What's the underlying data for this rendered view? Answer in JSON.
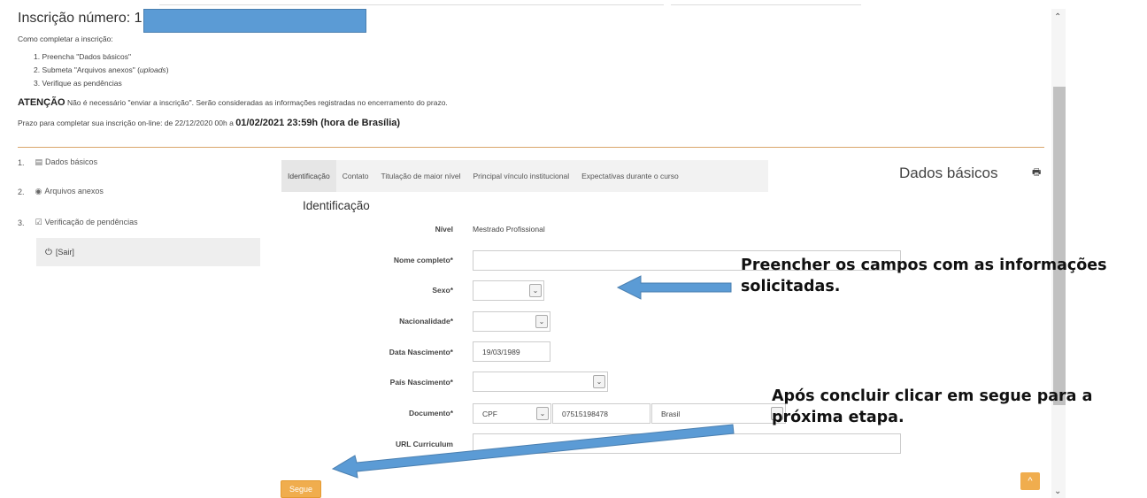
{
  "header": {
    "title": "Inscrição número: 1"
  },
  "instructions": {
    "heading": "Como completar a inscrição:",
    "step1": "1. Preencha \"Dados básicos\"",
    "step2_pre": "2. Submeta \"Arquivos anexos\" (",
    "step2_em": "uploads",
    "step2_post": ")",
    "step3": "3. Verifique as pendências",
    "attention_label": "ATENÇÃO",
    "attention_text": " Não é necessário \"enviar a inscrição\". Serão consideradas as informações registradas no encerramento do prazo.",
    "deadline_text": "Prazo para completar sua inscrição on-line: de 22/12/2020 00h a ",
    "deadline_bold": "01/02/2021 23:59h (hora de Brasília)"
  },
  "sidebar": {
    "items": [
      {
        "num": "1.",
        "label": "Dados básicos"
      },
      {
        "num": "2.",
        "label": "Arquivos anexos"
      },
      {
        "num": "3.",
        "label": "Verificação de pendências"
      }
    ],
    "exit_label": "[Sair]"
  },
  "tabs": [
    {
      "label": "Identificação"
    },
    {
      "label": "Contato"
    },
    {
      "label": "Titulação de maior nível"
    },
    {
      "label": "Principal vínculo institucional"
    },
    {
      "label": "Expectativas durante o curso"
    }
  ],
  "section": {
    "title": "Dados básicos",
    "subtitle": "Identificação"
  },
  "form": {
    "nivel_label": "Nível",
    "nivel_value": "Mestrado Profissional",
    "nome_label": "Nome completo*",
    "nome_value": "",
    "sexo_label": "Sexo*",
    "sexo_value": "",
    "nacionalidade_label": "Nacionalidade*",
    "nacionalidade_value": "",
    "data_label": "Data Nascimento*",
    "data_value": "19/03/1989",
    "pais_label": "País Nascimento*",
    "pais_value": "",
    "documento_label": "Documento*",
    "doc_type": "CPF",
    "doc_number": "07515198478",
    "doc_country": "Brasil",
    "url_label": "URL Curriculum",
    "url_value": ""
  },
  "annotations": {
    "fill_line1": "Preencher os campos com as informações",
    "fill_line2": "solicitadas.",
    "next_line1": "Após concluir clicar em segue para a",
    "next_line2": "próxima etapa."
  },
  "buttons": {
    "next_label": "Segue",
    "top_label": "^"
  },
  "colors": {
    "accent": "#f0ad4e",
    "arrow": "#5b9bd5",
    "redaction": "#5b9bd5",
    "divider": "#d9a56a"
  }
}
